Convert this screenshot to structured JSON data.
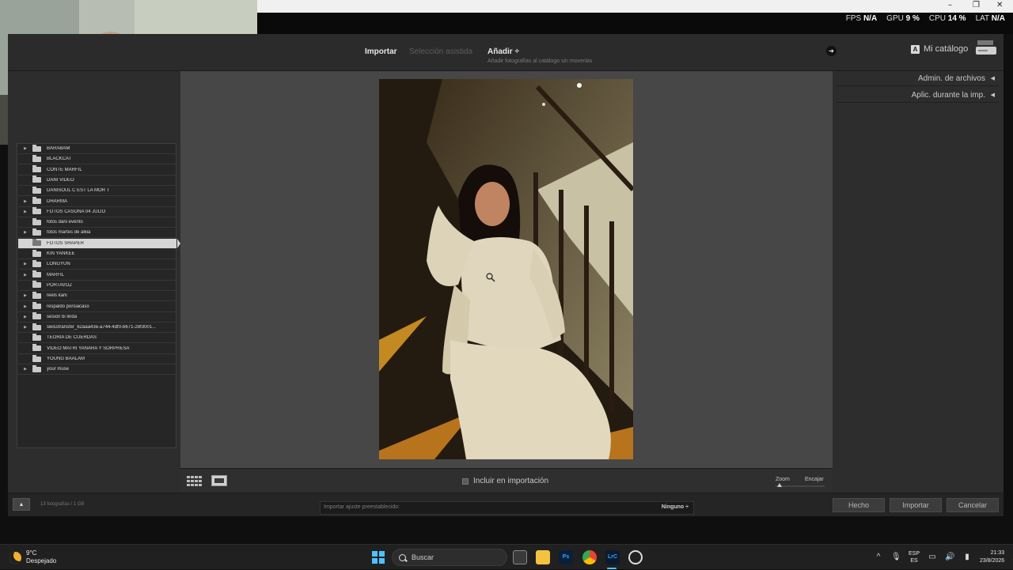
{
  "overlay_stats": [
    {
      "label": "FPS",
      "value": "N/A"
    },
    {
      "label": "GPU",
      "value": "9 %"
    },
    {
      "label": "CPU",
      "value": "14 %"
    },
    {
      "label": "LAT",
      "value": "N/A"
    }
  ],
  "window_controls": {
    "minimize": "–",
    "restore": "❐",
    "close": "✕"
  },
  "header": {
    "importar": "Importar",
    "seleccion": "Selección asistida",
    "anadir": "Añadir ÷",
    "anadir_sub": "Añadir fotografías al catálogo sin moverlas",
    "catalog_badge": "A",
    "catalog": "Mi catálogo"
  },
  "folders": [
    {
      "name": "BARABAM",
      "expandable": true,
      "selected": false
    },
    {
      "name": "BLACKCAT",
      "expandable": false,
      "selected": false
    },
    {
      "name": "CONTE MARFIL",
      "expandable": false,
      "selected": false
    },
    {
      "name": "DANI VIDEO",
      "expandable": false,
      "selected": false
    },
    {
      "name": "DANISOUL C EST LA MOR T",
      "expandable": false,
      "selected": false
    },
    {
      "name": "DHARMA",
      "expandable": true,
      "selected": false
    },
    {
      "name": "FOTOS CASONA 04 JULIO",
      "expandable": true,
      "selected": false
    },
    {
      "name": "fotos dani evento",
      "expandable": false,
      "selected": false
    },
    {
      "name": "fotos martes de alkia",
      "expandable": true,
      "selected": false
    },
    {
      "name": "FOTOS SHAPER",
      "expandable": false,
      "selected": true
    },
    {
      "name": "KIN YANKEE",
      "expandable": false,
      "selected": false
    },
    {
      "name": "LONGYUN",
      "expandable": true,
      "selected": false
    },
    {
      "name": "MARFIL",
      "expandable": true,
      "selected": false
    },
    {
      "name": "PORTAVOZ",
      "expandable": false,
      "selected": false
    },
    {
      "name": "reels karli",
      "expandable": true,
      "selected": false
    },
    {
      "name": "respaldo porsiacaso",
      "expandable": true,
      "selected": false
    },
    {
      "name": "sesion bi linda",
      "expandable": true,
      "selected": false
    },
    {
      "name": "swisstransfer_62aaa43e-a744-4df0-b671-28f3001...",
      "expandable": true,
      "selected": false
    },
    {
      "name": "TEORIA DE CUERDAS",
      "expandable": false,
      "selected": false
    },
    {
      "name": "VIDEO MATRI YANARA Y SORPRESA",
      "expandable": false,
      "selected": false
    },
    {
      "name": "YOUNG BAALAM",
      "expandable": false,
      "selected": false
    },
    {
      "name": "your muse",
      "expandable": true,
      "selected": false
    }
  ],
  "right_panel": {
    "admin": "Admin. de archivos",
    "aplic": "Aplic. durante la imp.",
    "caret": "◀"
  },
  "toolbar": {
    "include": "Incluir en importación",
    "zoom": "Zoom",
    "fit": "Encajar"
  },
  "footer": {
    "collapse": "▲",
    "photo_count": "13 fotografías / 1 GB",
    "preset_label": "Importar ajuste preestablecido:",
    "preset_value": "Ninguno ÷",
    "hecho": "Hecho",
    "importar": "Importar",
    "cancelar": "Cancelar"
  },
  "taskbar": {
    "temp": "9°C",
    "weather": "Despejado",
    "search": "Buscar",
    "apps": [
      {
        "name": "task-view",
        "label": ""
      },
      {
        "name": "file-explorer",
        "label": ""
      },
      {
        "name": "photoshop",
        "label": "Ps"
      },
      {
        "name": "chrome",
        "label": ""
      },
      {
        "name": "lightroom-classic",
        "label": "LrC"
      },
      {
        "name": "steam",
        "label": ""
      }
    ],
    "lang1": "ESP",
    "lang2": "ES",
    "time": "21:33",
    "date": "23/8/2026"
  },
  "colors": {
    "accent": "#4cc2ff",
    "selected_row": "#d5d5d5",
    "panel": "#2d2d2d",
    "preview_bg": "#474747"
  }
}
